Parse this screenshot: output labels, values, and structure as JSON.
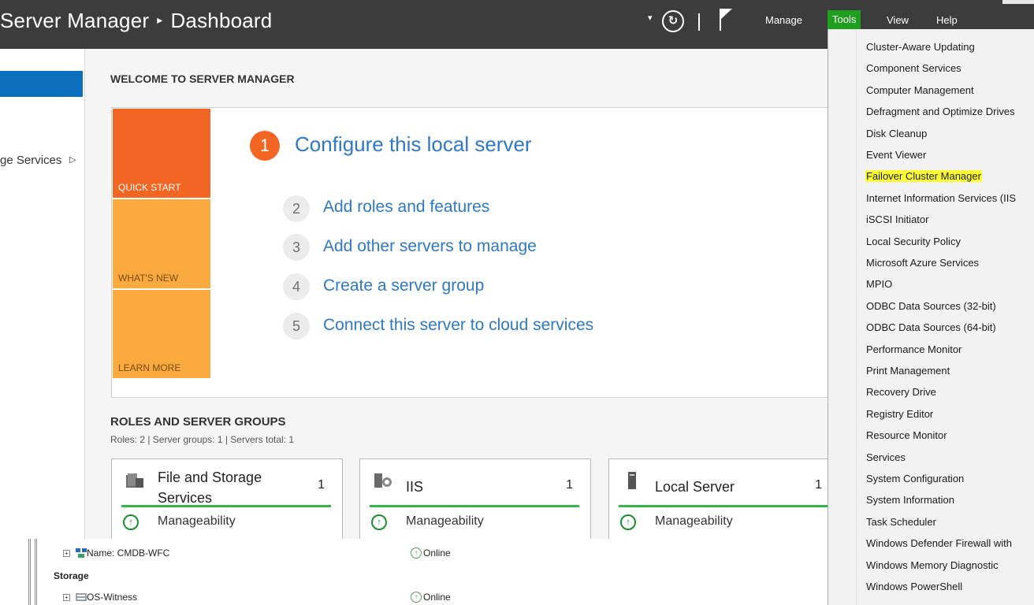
{
  "titlebar": {
    "app": "Server Manager",
    "separator": "▸",
    "page": "Dashboard",
    "menu": {
      "manage": "Manage",
      "tools": "Tools",
      "view": "View",
      "help": "Help"
    },
    "colors": {
      "bar": "#3c3c3c",
      "tools_active": "#1f9e1f"
    }
  },
  "leftnav": {
    "partial_item": "ge Services"
  },
  "main": {
    "welcome": "WELCOME TO SERVER MANAGER",
    "tiles": {
      "quick_start": "QUICK START",
      "whats_new": "WHAT'S NEW",
      "learn_more": "LEARN MORE"
    },
    "steps": [
      {
        "num": "1",
        "label": "Configure this local server"
      },
      {
        "num": "2",
        "label": "Add roles and features"
      },
      {
        "num": "3",
        "label": "Add other servers to manage"
      },
      {
        "num": "4",
        "label": "Create a server group"
      },
      {
        "num": "5",
        "label": "Connect this server to cloud services"
      }
    ],
    "roles_title": "ROLES AND SERVER GROUPS",
    "roles_sub": "Roles: 2   |   Server groups: 1   |   Servers total: 1",
    "cards": [
      {
        "title_line1": "File and Storage",
        "title_line2": "Services",
        "count": "1",
        "status": "Manageability"
      },
      {
        "title_line1": "IIS",
        "title_line2": "",
        "count": "1",
        "status": "Manageability"
      },
      {
        "title_line1": "Local Server",
        "title_line2": "",
        "count": "1",
        "status": "Manageability"
      }
    ]
  },
  "cluster_list": {
    "row1_name": "Name: CMDB-WFC",
    "row1_status": "Online",
    "section": "Storage",
    "row2_name": "OS-Witness",
    "row2_status": "Online"
  },
  "tools_menu": {
    "highlight_color": "#ffff33",
    "items": [
      "Cluster-Aware Updating",
      "Component Services",
      "Computer Management",
      "Defragment and Optimize Drives",
      "Disk Cleanup",
      "Event Viewer",
      "Failover Cluster Manager",
      "Internet Information Services (IIS",
      "iSCSI Initiator",
      "Local Security Policy",
      "Microsoft Azure Services",
      "MPIO",
      "ODBC Data Sources (32-bit)",
      "ODBC Data Sources (64-bit)",
      "Performance Monitor",
      "Print Management",
      "Recovery Drive",
      "Registry Editor",
      "Resource Monitor",
      "Services",
      "System Configuration",
      "System Information",
      "Task Scheduler",
      "Windows Defender Firewall with",
      "Windows Memory Diagnostic",
      "Windows PowerShell"
    ]
  }
}
